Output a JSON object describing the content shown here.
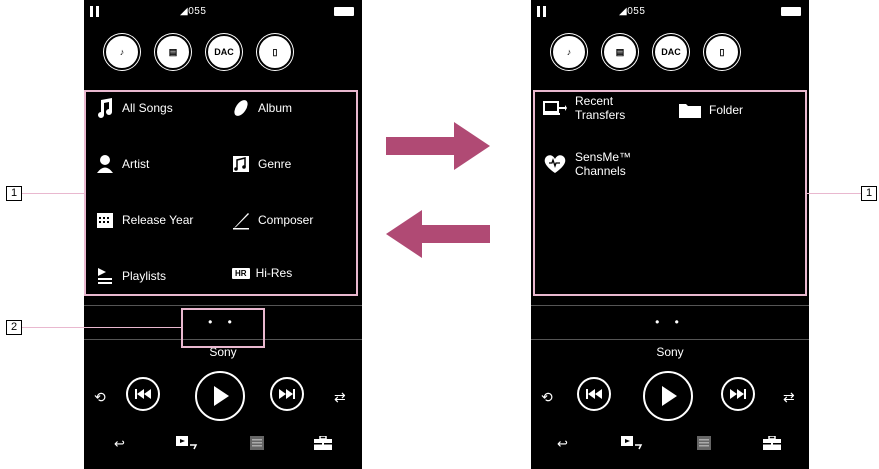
{
  "status": {
    "volume": "◢055"
  },
  "left_screen": {
    "quick_buttons": [
      "♪",
      "▤",
      "DAC",
      "▯"
    ],
    "menu_items": [
      {
        "label": "All Songs"
      },
      {
        "label": "Album"
      },
      {
        "label": "Artist"
      },
      {
        "label": "Genre"
      },
      {
        "label": "Release Year"
      },
      {
        "label": "Composer"
      },
      {
        "label": "Playlists"
      },
      {
        "label": "Hi-Res",
        "badge": "HR"
      }
    ],
    "page_dots": "• •",
    "song_title": "Sony"
  },
  "right_screen": {
    "quick_buttons": [
      "♪",
      "▤",
      "DAC",
      "▯"
    ],
    "menu_items": [
      {
        "label_line1": "Recent",
        "label_line2": "Transfers"
      },
      {
        "label": "Folder"
      },
      {
        "label_line1": "SensMe™",
        "label_line2": "Channels"
      }
    ],
    "page_dots": "• •",
    "song_title": "Sony"
  },
  "callouts": {
    "one": "1",
    "two": "2"
  },
  "colors": {
    "highlight": "#e9b8cf",
    "arrow": "#b04a74",
    "screen": "#000000"
  }
}
